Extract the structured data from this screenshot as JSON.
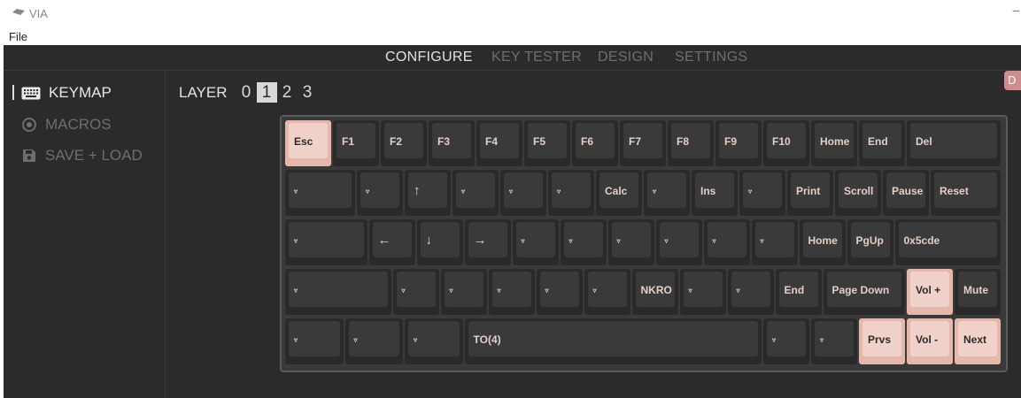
{
  "window": {
    "title": "VIA",
    "menu_file": "File",
    "control": "–"
  },
  "nav": {
    "configure": "CONFIGURE",
    "key_tester": "KEY TESTER",
    "design": "DESIGN",
    "settings": "SETTINGS"
  },
  "sidebar": {
    "keymap": "KEYMAP",
    "macros": "MACROS",
    "save_load": "SAVE + LOAD"
  },
  "layer": {
    "label": "LAYER",
    "layers": [
      "0",
      "1",
      "2",
      "3"
    ],
    "selected": "1"
  },
  "side_tab": "D",
  "keyboard": {
    "rows": [
      [
        {
          "label": "Esc",
          "pink": true
        },
        {
          "label": "F1"
        },
        {
          "label": "F2"
        },
        {
          "label": "F3"
        },
        {
          "label": "F4"
        },
        {
          "label": "F5"
        },
        {
          "label": "F6"
        },
        {
          "label": "F7"
        },
        {
          "label": "F8"
        },
        {
          "label": "F9"
        },
        {
          "label": "F10"
        },
        {
          "label": "Home"
        },
        {
          "label": "End"
        },
        {
          "label": "Del"
        }
      ],
      [
        {
          "label": "▿"
        },
        {
          "label": "▿"
        },
        {
          "label": "↑"
        },
        {
          "label": "▿"
        },
        {
          "label": "▿"
        },
        {
          "label": "▿"
        },
        {
          "label": "Calc"
        },
        {
          "label": "▿"
        },
        {
          "label": "Ins"
        },
        {
          "label": "▿"
        },
        {
          "label": "Print"
        },
        {
          "label": "Scroll"
        },
        {
          "label": "Pause"
        },
        {
          "label": "Reset"
        }
      ],
      [
        {
          "label": "▿"
        },
        {
          "label": "←"
        },
        {
          "label": "↓"
        },
        {
          "label": "→"
        },
        {
          "label": "▿"
        },
        {
          "label": "▿"
        },
        {
          "label": "▿"
        },
        {
          "label": "▿"
        },
        {
          "label": "▿"
        },
        {
          "label": "▿"
        },
        {
          "label": "Home"
        },
        {
          "label": "PgUp"
        },
        {
          "label": "0x5cde"
        }
      ],
      [
        {
          "label": "▿"
        },
        {
          "label": "▿"
        },
        {
          "label": "▿"
        },
        {
          "label": "▿"
        },
        {
          "label": "▿"
        },
        {
          "label": "▿"
        },
        {
          "label": "NKRO"
        },
        {
          "label": "▿"
        },
        {
          "label": "▿"
        },
        {
          "label": "End"
        },
        {
          "label": "Page Down"
        },
        {
          "label": "Vol +",
          "pink": true
        },
        {
          "label": "Mute"
        }
      ],
      [
        {
          "label": "▿"
        },
        {
          "label": "▿"
        },
        {
          "label": "▿"
        },
        {
          "label": "TO(4)"
        },
        {
          "label": "▿"
        },
        {
          "label": "▿"
        },
        {
          "label": "Prvs",
          "pink": true
        },
        {
          "label": "Vol -",
          "pink": true
        },
        {
          "label": "Next",
          "pink": true
        }
      ]
    ]
  }
}
